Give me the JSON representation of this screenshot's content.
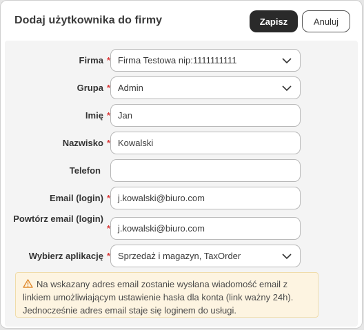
{
  "dialog": {
    "title": "Dodaj użytkownika do firmy",
    "save_label": "Zapisz",
    "cancel_label": "Anuluj"
  },
  "form": {
    "required_mark": "*",
    "company": {
      "label": "Firma",
      "value": "Firma Testowa nip:1111111111"
    },
    "group": {
      "label": "Grupa",
      "value": "Admin"
    },
    "first_name": {
      "label": "Imię",
      "value": "Jan"
    },
    "last_name": {
      "label": "Nazwisko",
      "value": "Kowalski"
    },
    "phone": {
      "label": "Telefon",
      "value": ""
    },
    "email": {
      "label": "Email (login)",
      "value": "j.kowalski@biuro.com"
    },
    "email_repeat": {
      "label": "Powtórz email (login)",
      "value": "j.kowalski@biuro.com"
    },
    "app": {
      "label": "Wybierz aplikację",
      "value": "Sprzedaż i magazyn, TaxOrder"
    }
  },
  "notice": {
    "icon": "warning-triangle",
    "line1": "Na wskazany adres email zostanie wysłana wiadomość email z",
    "line2": "linkiem umożliwiającym ustawienie hasła dla konta (link ważny 24h).",
    "line3": "Jednocześnie adres email staje się loginem do usługi."
  },
  "colors": {
    "primary_button": "#2a2a2a",
    "required": "#d93a3a",
    "notice_bg": "#fdf4e1",
    "warning_icon": "#e0892b"
  }
}
